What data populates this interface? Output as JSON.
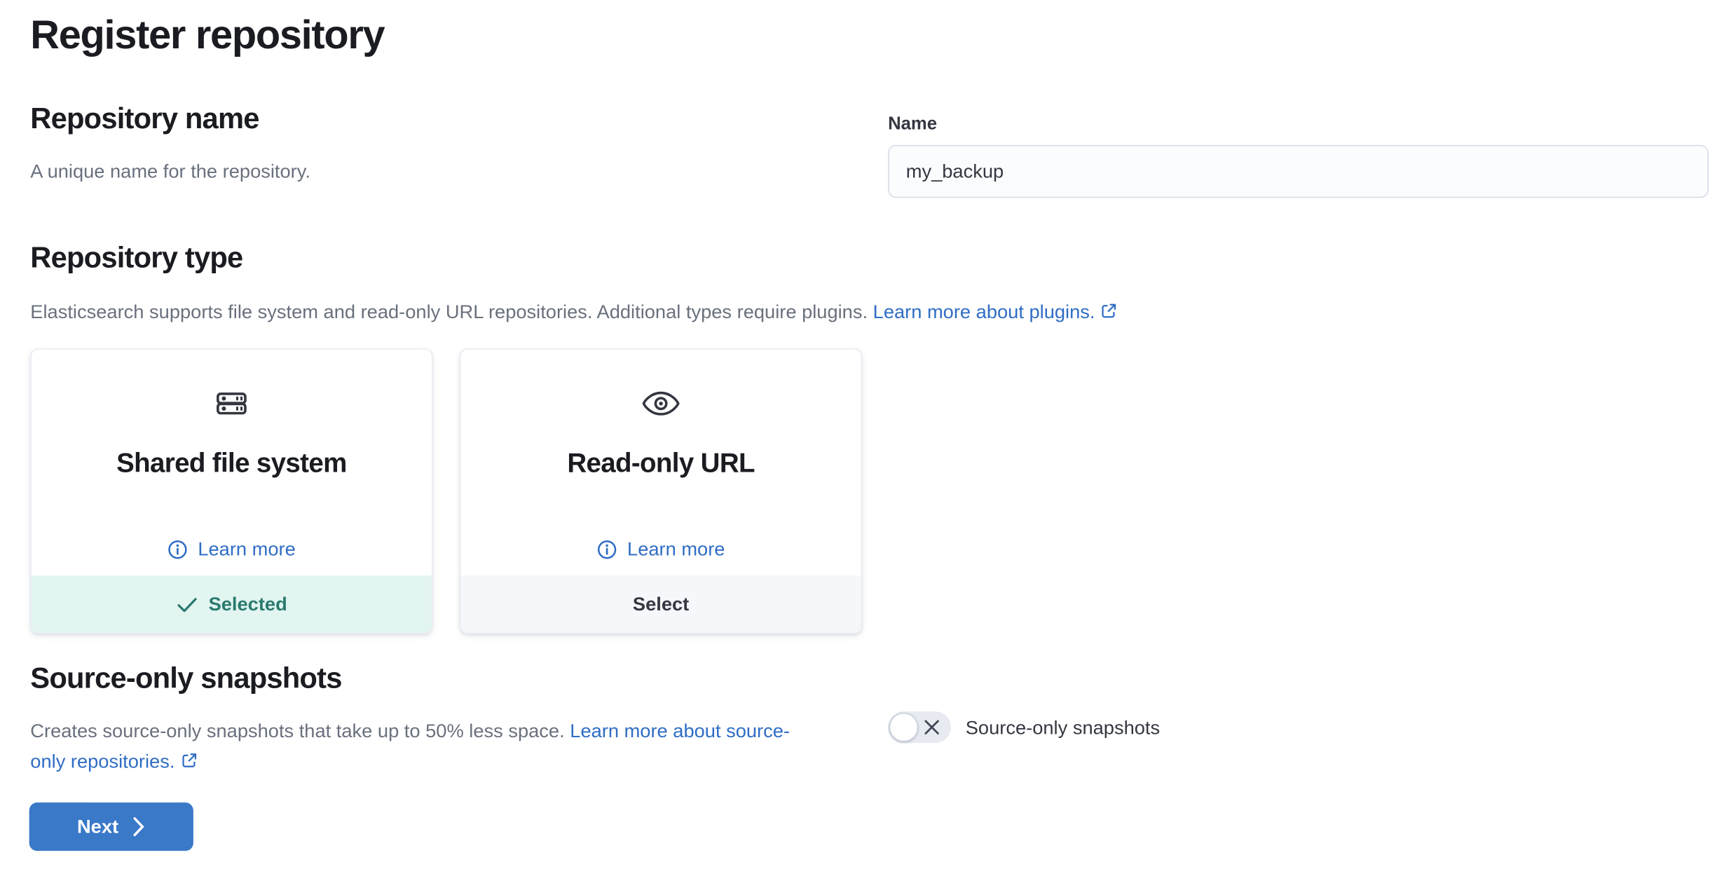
{
  "page": {
    "title": "Register repository"
  },
  "colors": {
    "link_blue": "#2f6dc5",
    "button_blue": "#3a78c8",
    "success_teal_text": "#2a7a6e",
    "success_teal_bg": "#e2f5f0",
    "footer_gray_bg": "#f5f7fa",
    "heading_text": "#1a1c21",
    "body_gray_text": "#69707d",
    "icon_slate": "#33363f"
  },
  "repository_name": {
    "heading": "Repository name",
    "description": "A unique name for the repository.",
    "field_label": "Name",
    "field_value": "my_backup"
  },
  "repository_type": {
    "heading": "Repository type",
    "description": "Elasticsearch supports file system and read-only URL repositories. Additional types require plugins.",
    "link_label": "Learn more about plugins.",
    "cards": [
      {
        "title": "Shared file system",
        "icon": "storage-icon",
        "learn_more_label": "Learn more",
        "footer_label": "Selected",
        "state": "selected"
      },
      {
        "title": "Read-only URL",
        "icon": "eye-icon",
        "learn_more_label": "Learn more",
        "footer_label": "Select",
        "state": "unselected"
      }
    ]
  },
  "source_only": {
    "heading": "Source-only snapshots",
    "description": "Creates source-only snapshots that take up to 50% less space.",
    "link_label": "Learn more about source-only repositories.",
    "toggle_label": "Source-only snapshots",
    "toggle_state": "off"
  },
  "actions": {
    "next_label": "Next"
  }
}
